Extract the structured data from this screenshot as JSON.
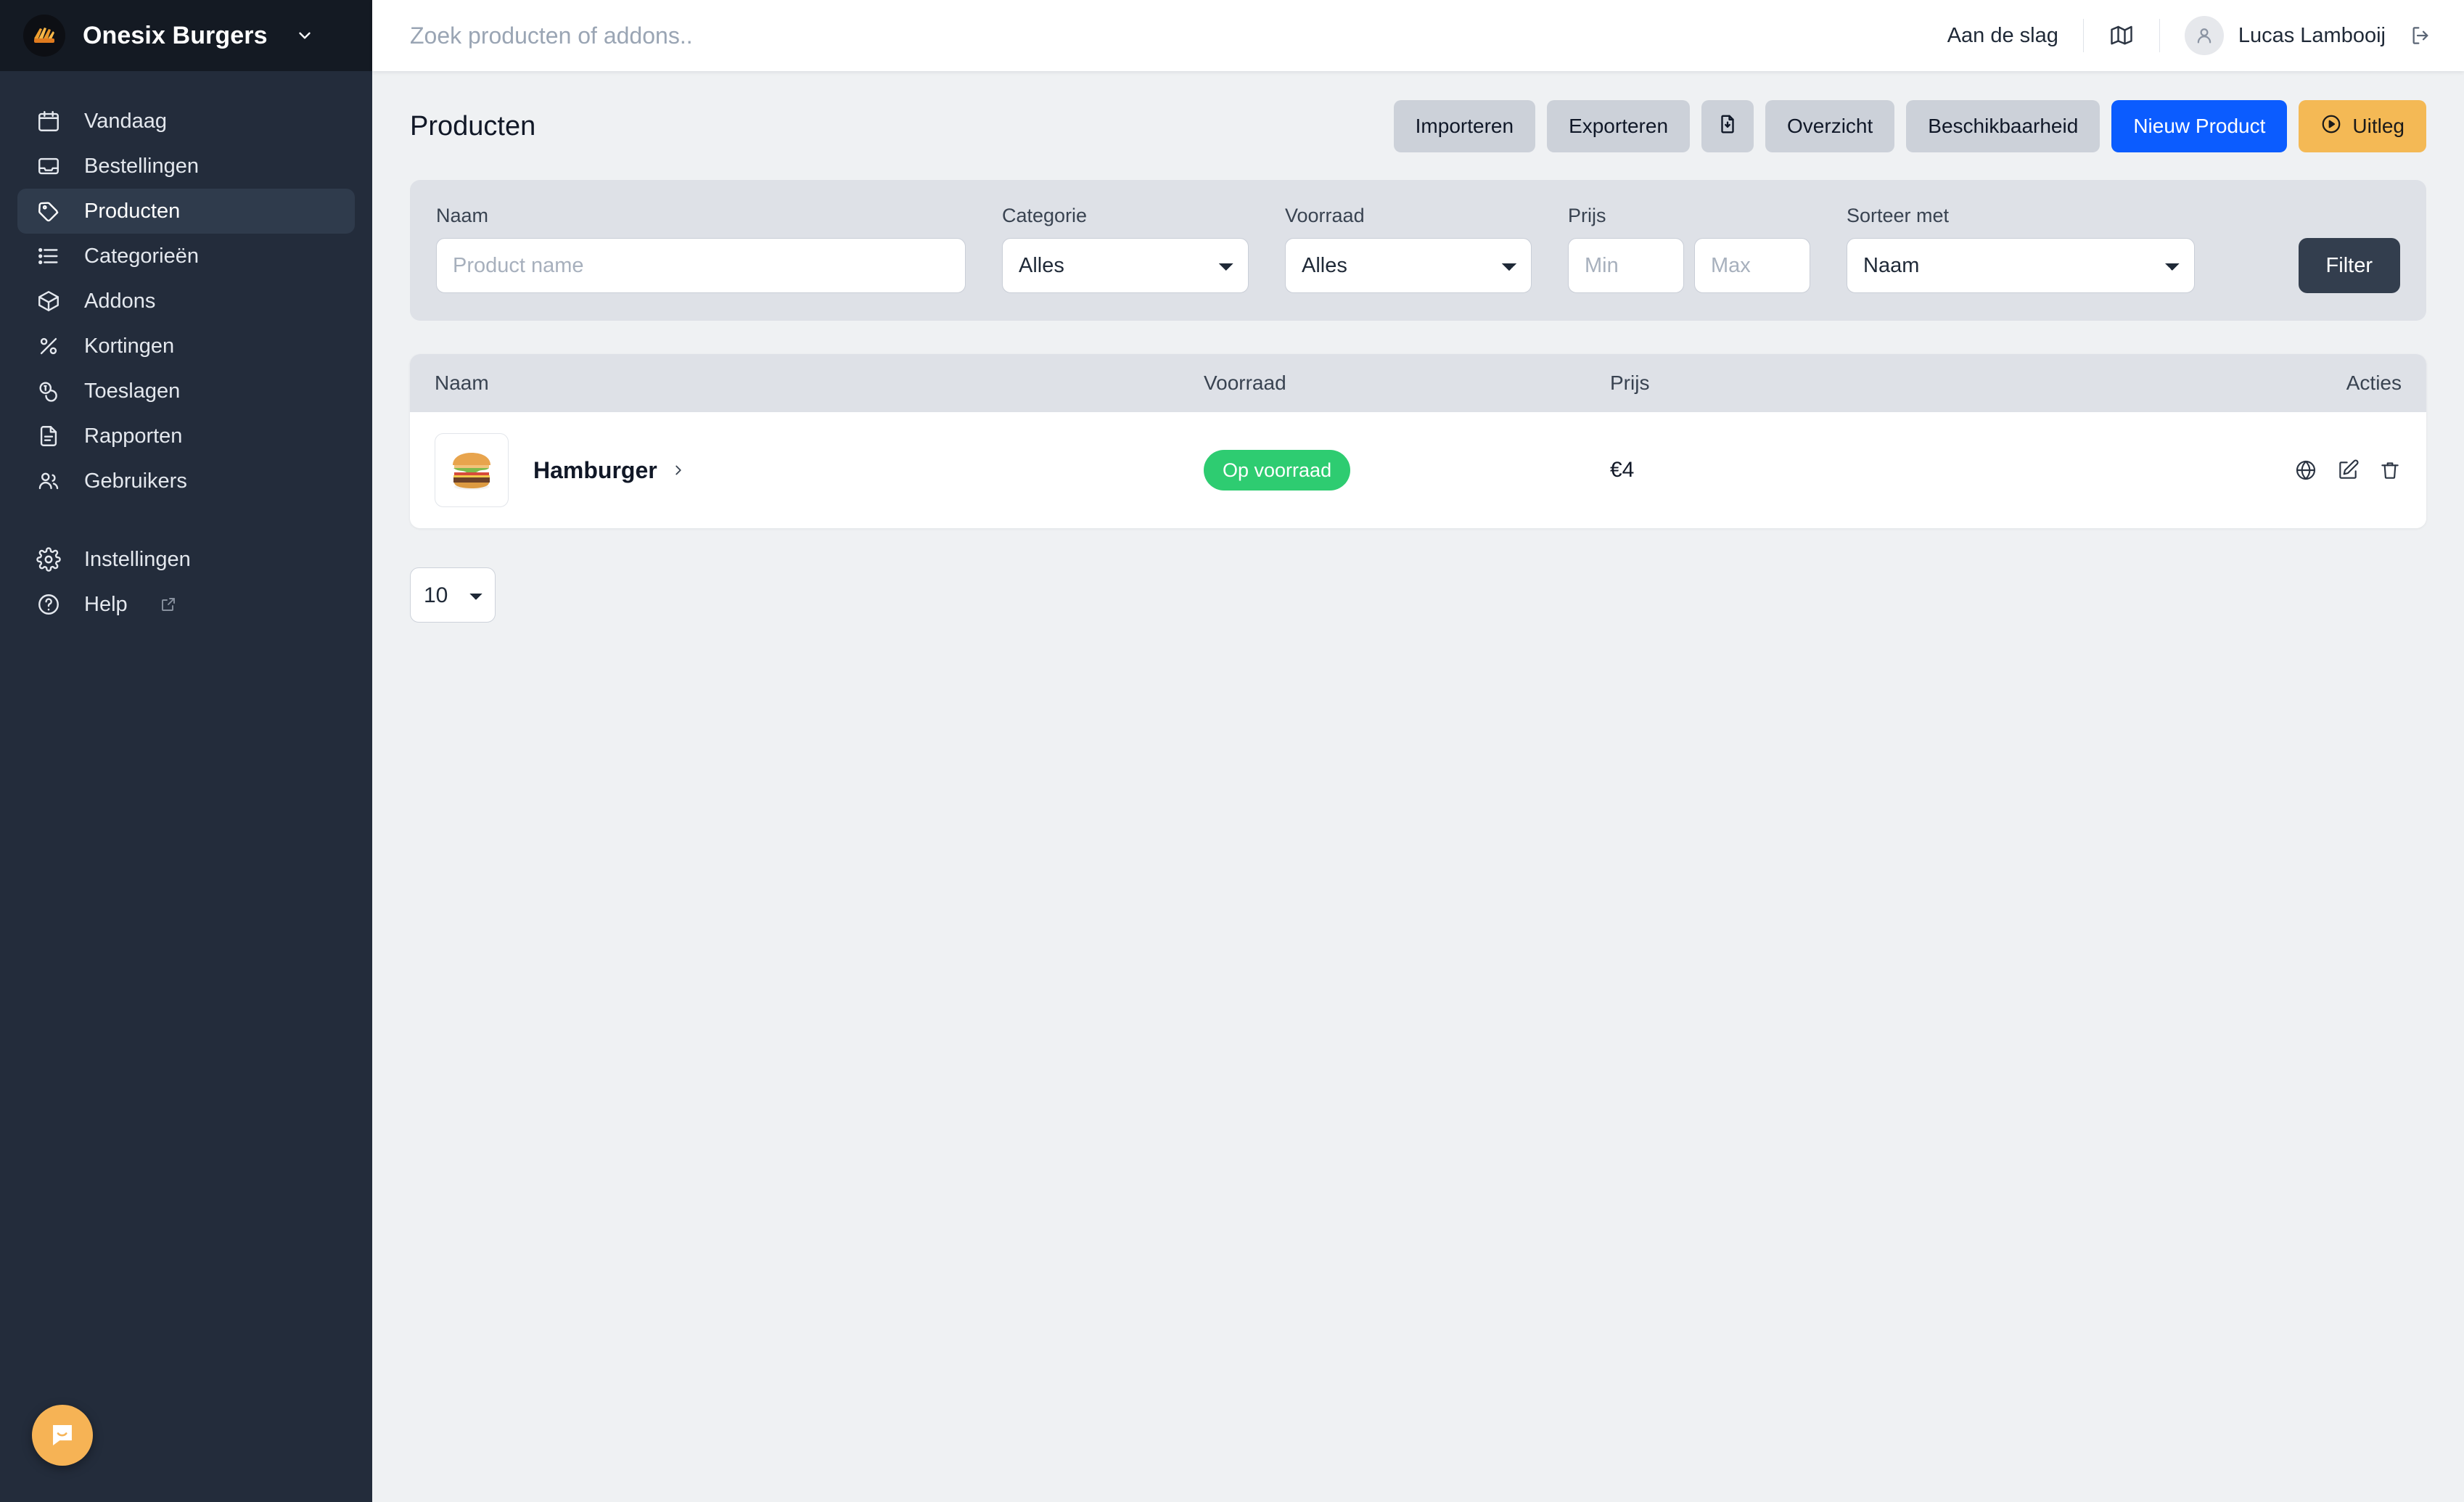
{
  "sidebar": {
    "brand": {
      "name": "Onesix Burgers",
      "logo_icon": "fries-logo-icon",
      "caret_icon": "chevron-down-icon"
    },
    "items": [
      {
        "label": "Vandaag",
        "icon": "calendar-icon",
        "active": false
      },
      {
        "label": "Bestellingen",
        "icon": "inbox-icon",
        "active": false
      },
      {
        "label": "Producten",
        "icon": "tag-icon",
        "active": true
      },
      {
        "label": "Categorieën",
        "icon": "list-bullet-icon",
        "active": false
      },
      {
        "label": "Addons",
        "icon": "cube-icon",
        "active": false
      },
      {
        "label": "Kortingen",
        "icon": "percent-icon",
        "active": false
      },
      {
        "label": "Toeslagen",
        "icon": "coins-icon",
        "active": false
      },
      {
        "label": "Rapporten",
        "icon": "document-text-icon",
        "active": false
      },
      {
        "label": "Gebruikers",
        "icon": "users-icon",
        "active": false
      }
    ],
    "footer_items": [
      {
        "label": "Instellingen",
        "icon": "gear-icon",
        "external": false
      },
      {
        "label": "Help",
        "icon": "question-circle-icon",
        "external": true,
        "external_icon": "external-link-icon"
      }
    ],
    "chat_bubble_icon": "chat-bubble-icon"
  },
  "topbar": {
    "search": {
      "value": "",
      "placeholder": "Zoek producten of addons.."
    },
    "getting_started_label": "Aan de slag",
    "map_icon": "map-icon",
    "avatar_icon": "user-avatar-icon",
    "user_name": "Lucas Lambooij",
    "logout_icon": "logout-icon"
  },
  "page": {
    "title": "Producten",
    "actions": [
      {
        "label": "Importeren",
        "style": "grey",
        "icon": null
      },
      {
        "label": "Exporteren",
        "style": "grey",
        "icon": null
      },
      {
        "label": "",
        "style": "grey",
        "icon": "file-download-icon"
      },
      {
        "label": "Overzicht",
        "style": "grey",
        "icon": null
      },
      {
        "label": "Beschikbaarheid",
        "style": "grey",
        "icon": null
      },
      {
        "label": "Nieuw Product",
        "style": "blue",
        "icon": null
      },
      {
        "label": "Uitleg",
        "style": "amber",
        "icon": "play-circle-icon"
      }
    ]
  },
  "filters": {
    "name": {
      "label": "Naam",
      "value": "",
      "placeholder": "Product name"
    },
    "category": {
      "label": "Categorie",
      "value": "Alles"
    },
    "stock": {
      "label": "Voorraad",
      "value": "Alles"
    },
    "price": {
      "label": "Prijs",
      "min_value": "",
      "min_placeholder": "Min",
      "max_value": "",
      "max_placeholder": "Max"
    },
    "sort": {
      "label": "Sorteer met",
      "value": "Naam"
    },
    "submit_label": "Filter"
  },
  "table": {
    "columns": [
      "Naam",
      "Voorraad",
      "Prijs",
      "Acties"
    ],
    "rows": [
      {
        "thumb_icon": "hamburger-thumbnail",
        "name": "Hamburger",
        "chevron_icon": "chevron-right-icon",
        "stock_badge": "Op voorraad",
        "price": "€4",
        "actions": [
          "globe-icon",
          "edit-icon",
          "trash-icon"
        ]
      }
    ]
  },
  "pagination": {
    "per_page": "10"
  },
  "colors": {
    "sidebar_bg": "#232c3b",
    "sidebar_brand_bg": "#141a23",
    "sidebar_active_bg": "#2f3b4c",
    "page_bg": "#eff1f3",
    "filterbar_bg": "#dee1e7",
    "primary_blue": "#0b5cff",
    "amber": "#f4b955",
    "badge_green": "#2ecc71",
    "filter_dark": "#333e4e",
    "chat_amber": "#f6b355"
  }
}
